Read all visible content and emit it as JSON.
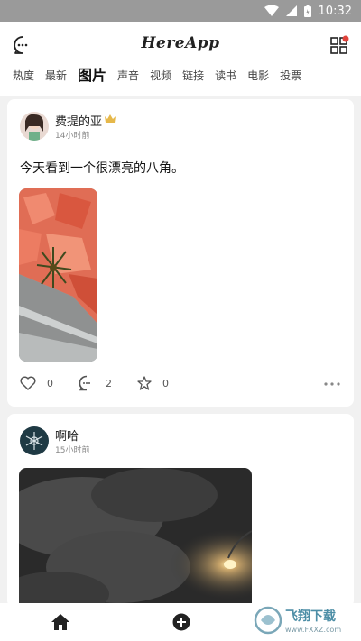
{
  "status_bar": {
    "time": "10:32"
  },
  "header": {
    "logo": "HereApp",
    "tabs": [
      {
        "label": "热度"
      },
      {
        "label": "最新"
      },
      {
        "label": "图片",
        "active": true
      },
      {
        "label": "声音"
      },
      {
        "label": "视频"
      },
      {
        "label": "链接"
      },
      {
        "label": "读书"
      },
      {
        "label": "电影"
      },
      {
        "label": "投票"
      }
    ]
  },
  "posts": [
    {
      "user": "费提的亚",
      "time": "14小时前",
      "text": "今天看到一个很漂亮的八角。",
      "likes": "0",
      "comments": "2",
      "stars": "0"
    },
    {
      "user": "啊哈",
      "time": "15小时前"
    }
  ],
  "watermark": {
    "text": "飞翔下载",
    "url": "www.FXXZ.com"
  },
  "colors": {
    "accent_dot": "#e0433b",
    "crown": "#e6b84a",
    "status_bar": "#9a9a9a"
  }
}
